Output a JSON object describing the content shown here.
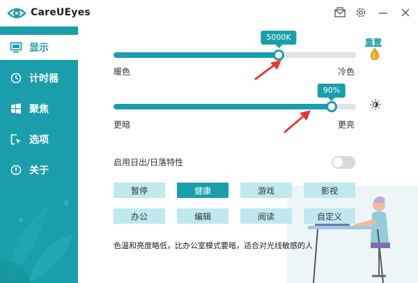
{
  "app": {
    "title": "CareUEyes"
  },
  "titlebar": {
    "buttons": [
      {
        "name": "mail-icon"
      },
      {
        "name": "gear-icon"
      },
      {
        "name": "minimize-icon"
      },
      {
        "name": "close-icon"
      }
    ]
  },
  "sidebar": {
    "items": [
      {
        "label": "显示",
        "icon": "monitor-icon",
        "active": true
      },
      {
        "label": "计时器",
        "icon": "clock-icon",
        "active": false
      },
      {
        "label": "聚焦",
        "icon": "windows-icon",
        "active": false
      },
      {
        "label": "选项",
        "icon": "cursor-box-icon",
        "active": false
      },
      {
        "label": "关于",
        "icon": "info-icon",
        "active": false
      }
    ]
  },
  "main": {
    "reset_label": "重置",
    "temperature": {
      "value_label": "5000K",
      "fraction": 0.68,
      "left_label": "暖色",
      "right_label": "冷色"
    },
    "brightness": {
      "value_label": "90%",
      "fraction": 0.9,
      "left_label": "更暗",
      "right_label": "更亮"
    },
    "sunrise_label": "启用日出/日落特性",
    "sunrise_enabled": false,
    "modes": [
      {
        "label": "暂停",
        "active": false
      },
      {
        "label": "健康",
        "active": true
      },
      {
        "label": "游戏",
        "active": false
      },
      {
        "label": "影视",
        "active": false
      },
      {
        "label": "办公",
        "active": false
      },
      {
        "label": "编辑",
        "active": false
      },
      {
        "label": "阅读",
        "active": false
      },
      {
        "label": "自定义",
        "active": false
      }
    ],
    "description": "色温和亮度略低，比办公室模式要暗，适合对光线敏感的人"
  },
  "colors": {
    "accent": "#1a9eab",
    "mode_button": "#bfe8ef",
    "arrow": "#e53935"
  }
}
